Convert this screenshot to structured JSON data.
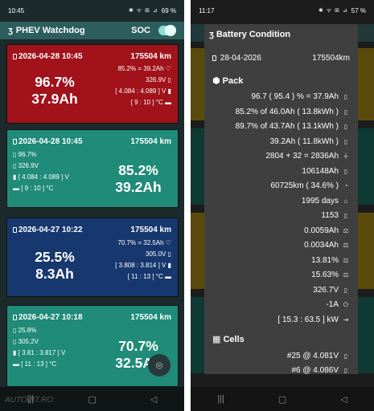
{
  "left": {
    "status": {
      "time": "10:45",
      "icons": "✱ ᯤ ⊞ ⊿",
      "battery": "69 %"
    },
    "appbar": {
      "title": "PHEV Watchdog",
      "soc_label": "SOC"
    },
    "cards": [
      {
        "date": "2026-04-28 10:45",
        "km": "175504 km",
        "pct": "96.7%",
        "ah": "37.9Ah",
        "l1": "85.2% = 39.2Ah",
        "l2": "326.9V",
        "l3": "[ 4.084 : 4.089 ] V",
        "l4": "[ 9 : 10 ] °C"
      },
      {
        "date": "2026-04-28 10:45",
        "km": "175504 km",
        "pct": "85.2%",
        "ah": "39.2Ah",
        "l1": "96.7%",
        "l2": "326.9V",
        "l3": "[ 4.084 : 4.089 ] V",
        "l4": "[ 9 : 10 ] °C"
      },
      {
        "date": "2026-04-27 10:22",
        "km": "175504 km",
        "pct": "25.5%",
        "ah": "8.3Ah",
        "l1": "70.7% = 32.5Ah",
        "l2": "305.0V",
        "l3": "[ 3.808 : 3.814 ] V",
        "l4": "[ 11 : 13 ] °C"
      },
      {
        "date": "2026-04-27 10:18",
        "km": "175504 km",
        "pct": "70.7%",
        "ah": "32.5Ah",
        "l1": "25.8%",
        "l2": "305.2V",
        "l3": "[ 3.81 : 3.817 ] V",
        "l4": "[ 11 : 13 ] °C"
      }
    ],
    "watermark": "AUTOVIT.RO"
  },
  "right": {
    "status": {
      "time": "11:17",
      "icons": "✱ ᯤ ⊞ ⊿",
      "battery": "57 %"
    },
    "popup": {
      "title": "Battery Condition",
      "date": "28-04-2026",
      "km": "175504km",
      "pack_label": "Pack",
      "rows": [
        "96.7 ( 95.4 ) % = 37.9Ah",
        "85.2% of 46.0Ah ( 13.8kWh )",
        "89.7% of 43.7Ah ( 13.1kWh )",
        "39.2Ah ( 11.8kWh )",
        "2804 + 32 = 2836Ah",
        "106148Ah",
        "60725km ( 34.6% )",
        "1995 days",
        "1153",
        "0.0059Ah",
        "0.0034Ah",
        "13.81%",
        "15.63%",
        "326.7V",
        "-1A",
        "[ 15.3 : 63.5 ] kW"
      ],
      "cells_label": "Cells",
      "cells": [
        "#25 @ 4.081V",
        "#6 @ 4.086V"
      ]
    }
  }
}
